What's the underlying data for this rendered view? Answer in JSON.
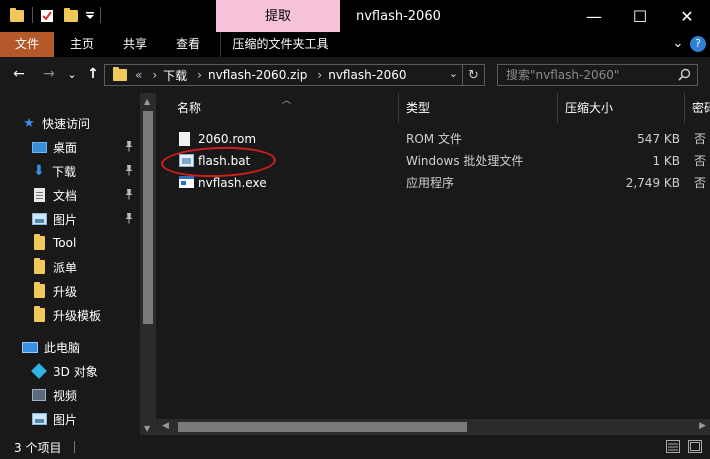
{
  "titlebar": {
    "context_tab": "提取",
    "title": "nvflash-2060",
    "minimize": "—",
    "maximize": "☐",
    "close": "✕"
  },
  "ribbon": {
    "tabs": [
      "文件",
      "主页",
      "共享",
      "查看",
      "压缩的文件夹工具"
    ],
    "collapse": "⌄",
    "help": "?"
  },
  "address": {
    "back": "←",
    "forward": "→",
    "recent": "⌄",
    "up": "↑",
    "overflow": "«",
    "crumbs": [
      "下载",
      "nvflash-2060.zip",
      "nvflash-2060"
    ],
    "sep": "›",
    "dropdown": "⌄",
    "refresh": "↻"
  },
  "search": {
    "placeholder": "搜索\"nvflash-2060\""
  },
  "nav": {
    "quick_access": "快速访问",
    "desktop": "桌面",
    "downloads": "下载",
    "documents": "文档",
    "pictures": "图片",
    "tool": "Tool",
    "paidan": "派单",
    "upgrade": "升级",
    "upgrade_template": "升级模板",
    "this_pc": "此电脑",
    "objects3d": "3D 对象",
    "videos": "视频",
    "pictures2": "图片",
    "pin": "📌"
  },
  "columns": {
    "name": "名称",
    "type": "类型",
    "compressed_size": "压缩大小",
    "password": "密码"
  },
  "files": [
    {
      "name": "2060.rom",
      "type": "ROM 文件",
      "size": "547 KB",
      "pw": "否",
      "icon": "file-icon"
    },
    {
      "name": "flash.bat",
      "type": "Windows 批处理文件",
      "size": "1 KB",
      "pw": "否",
      "icon": "batch-file-icon"
    },
    {
      "name": "nvflash.exe",
      "type": "应用程序",
      "size": "2,749 KB",
      "pw": "否",
      "icon": "exe-icon"
    }
  ],
  "status": {
    "count": "3 个项目"
  },
  "colors": {
    "file_tab": "#b5582a",
    "context_tab": "#f6c2da",
    "annotation": "#d41e1e"
  }
}
